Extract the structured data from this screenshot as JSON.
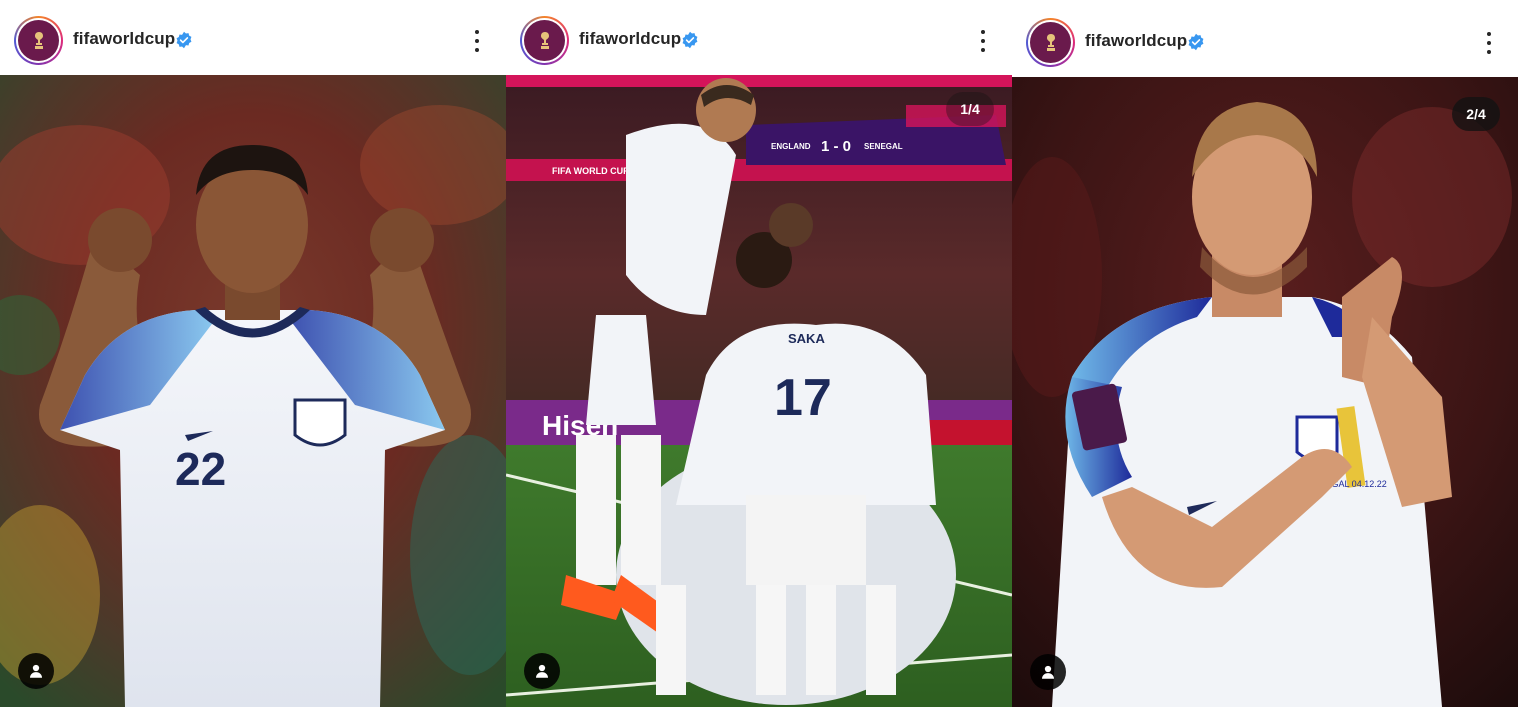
{
  "posts": [
    {
      "username": "fifaworldcup",
      "verified": true,
      "photo_subject": "",
      "counter": "",
      "jersey_number": "22"
    },
    {
      "username": "fifaworldcup",
      "verified": true,
      "counter": "1/4",
      "scoreboard": {
        "home": "ENGLAND",
        "score": "1 - 0",
        "away": "SENEGAL"
      },
      "banner_text": "FIFA WORLD CUP Qatar2022",
      "ad_text": "Hisen",
      "player_name": "SAKA",
      "jersey_number": "17"
    },
    {
      "username": "fifaworldcup",
      "verified": true,
      "counter": "2/4",
      "shirt_text": "SENEGAL 04.12.22"
    }
  ],
  "icons": {
    "avatar": "fifa-trophy-icon",
    "verified": "verified-badge-icon",
    "more": "more-options-icon",
    "tag": "tagged-user-icon"
  },
  "colors": {
    "verified_blue": "#3897f0",
    "fifa_maroon": "#6a1a4c",
    "england_navy": "#1d2a5a"
  }
}
